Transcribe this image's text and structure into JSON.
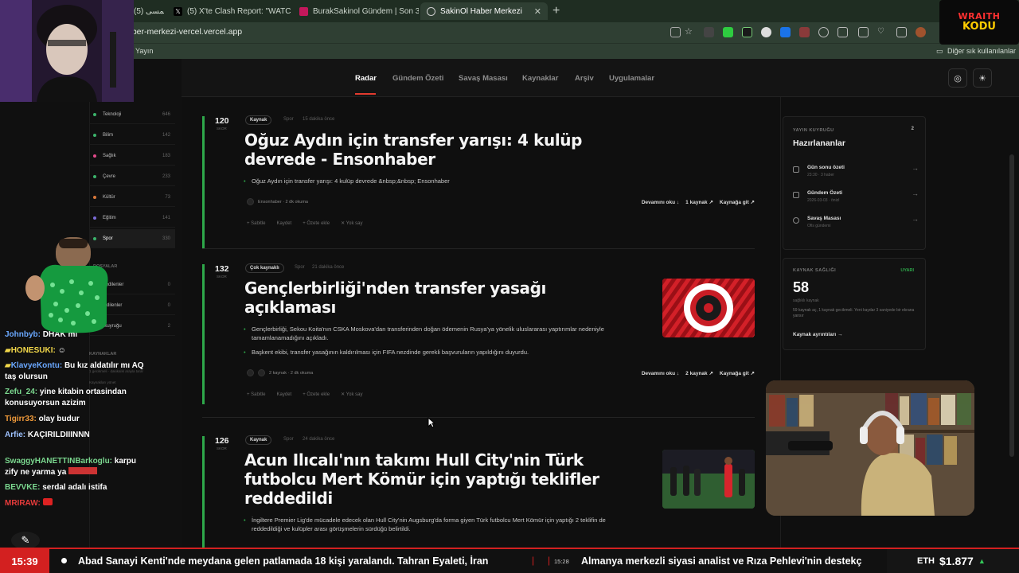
{
  "browser": {
    "tabs": [
      {
        "label": "شمسی (5)"
      },
      {
        "label": "(5) X'te Clash Report: \"WATCH: Ru"
      },
      {
        "label": "BurakSakinol Gündem | Son 3 Gün"
      },
      {
        "label": "SakinOl Haber Merkezi"
      }
    ],
    "url": "aber-merkezi-vercel.vercel.app",
    "bookmarks": {
      "left": "Yayın",
      "right": "Diğer sık kullanılanlar"
    }
  },
  "nav": {
    "items": [
      "Radar",
      "Gündem Özeti",
      "Savaş Masası",
      "Kaynaklar",
      "Arşiv",
      "Uygulamalar"
    ],
    "active": "Radar",
    "accent": "#e23a2e"
  },
  "categories": [
    {
      "label": "Teknoloji",
      "count": "646",
      "color": "#3bb36b"
    },
    {
      "label": "Bilim",
      "count": "142",
      "color": "#3bb36b"
    },
    {
      "label": "Sağlık",
      "count": "183",
      "color": "#e24a8a"
    },
    {
      "label": "Çevre",
      "count": "233",
      "color": "#3bb36b"
    },
    {
      "label": "Kültür",
      "count": "73",
      "color": "#d8783a"
    },
    {
      "label": "Eğitim",
      "count": "141",
      "color": "#7b6bd8"
    },
    {
      "label": "Spor",
      "count": "330",
      "color": "#3bb36b"
    }
  ],
  "sidebar_extra": {
    "section1": "DOSYALAR",
    "items": [
      {
        "label": "Takip edilenler",
        "count": "0"
      },
      {
        "label": "Kaydedilenler",
        "count": "0"
      },
      {
        "label": "Özet kuyruğu",
        "count": "2"
      }
    ],
    "section2": "KAYNAKLAR",
    "note": "1 gecikmeli · dakikalık arayla tarar",
    "note2": "Kaynakları yönet"
  },
  "chat": [
    {
      "user": "Johnbyb:",
      "msg": "DHAK mı",
      "color": "#6aa8ff"
    },
    {
      "user": "HONESUKI:",
      "msg": "",
      "color": "#f2d84a"
    },
    {
      "user": "KlavyeKontu:",
      "msg": "Bu kız aldatılır mı AQ taş olursun",
      "color": "#6aa8ff"
    },
    {
      "user": "Zefu_24:",
      "msg": "yine kitabin ortasindan konusuyorsun azizim",
      "color": "#7bd88f"
    },
    {
      "user": "Tigirr33:",
      "msg": "olay budur",
      "color": "#f29b3a"
    },
    {
      "user": "Arfie:",
      "msg": "KAÇIRILDIIINNN",
      "color": "#9ec2ff"
    },
    {
      "user": "SwaggyHANETTINBarkoglu:",
      "msg": "karpu zify ne yarma ya",
      "color": "#7bd88f"
    },
    {
      "user": "BEVVKE:",
      "msg": "serdal adalı istifa",
      "color": "#7bd88f"
    },
    {
      "user": "MRIRAW:",
      "msg": "",
      "color": "#e63b3b"
    }
  ],
  "articles": [
    {
      "number": "120",
      "number_label": "SKOR",
      "badge": "Kaynak",
      "category": "Spor",
      "time": "15 dakika önce",
      "title": "Oğuz Aydın için transfer yarışı: 4 kulüp devrede - Ensonhaber",
      "bullets": [
        "Oğuz Aydın için transfer yarışı: 4 kulüp devrede &nbsp;&nbsp; Ensonhaber"
      ],
      "source": "Ensonhaber · 2 dk okuma",
      "links": {
        "more": "Devamını oku ↓",
        "sources": "1 kaynak ↗",
        "go": "Kaynağa git ↗"
      },
      "footer": [
        "+ Sabitle",
        "Kaydet",
        "+ Özete ekle",
        "✕ Yok say"
      ]
    },
    {
      "number": "132",
      "number_label": "SKOR",
      "badge": "Çok kaynaklı",
      "category": "Spor",
      "time": "21 dakika önce",
      "title": "Gençlerbirliği'nden transfer yasağı açıklaması",
      "bullets": [
        "Gençlerbirliği, Sekou Koita'nın CSKA Moskova'dan transferinden doğan ödemenin Rusya'ya yönelik uluslararası yaptırımlar nedeniyle tamamlanamadığını açıkladı.",
        "Başkent ekibi, transfer yasağının kaldırılması için FIFA nezdinde gerekli başvuruların yapıldığını duyurdu."
      ],
      "source": "2 kaynak · 2 dk okuma",
      "links": {
        "more": "Devamını oku ↓",
        "sources": "2 kaynak ↗",
        "go": "Kaynağa git ↗"
      },
      "footer": [
        "+ Sabitle",
        "Kaydet",
        "+ Özete ekle",
        "✕ Yok say"
      ],
      "logo_text": "ANKARA · GENÇLERBİRLİĞİ SPOR KULÜBÜ"
    },
    {
      "number": "126",
      "number_label": "SKOR",
      "badge": "Kaynak",
      "category": "Spor",
      "time": "24 dakika önce",
      "title": "Acun Ilıcalı'nın takımı Hull City'nin Türk futbolcu Mert Kömür için yaptığı teklifler reddedildi",
      "bullets": [
        "İngiltere Premier Lig'de mücadele edecek olan Hull City'nin Augsburg'da forma giyen Türk futbolcu Mert Kömür için yaptığı 2 teklifin de reddedildiği ve kulüpler arası görüşmelerin sürdüğü belirtildi."
      ]
    }
  ],
  "queue": {
    "label": "YAYIN KUYRUĞU",
    "count": "2",
    "title": "Hazırlananlar",
    "items": [
      {
        "title": "Gün sonu özeti",
        "sub": "23:30 · 3 haber"
      },
      {
        "title": "Gündem Özeti",
        "sub": "2026-03-03 · önizl"
      },
      {
        "title": "Savaş Masası",
        "sub": "Ofis gündemi"
      }
    ]
  },
  "health": {
    "label": "KAYNAK SAĞLIĞI",
    "status": "UYARI",
    "status_color": "#2ea84a",
    "value": "58",
    "value_label": "sağlıklı kaynak",
    "note": "59 kaynak aç, 1 kaynak gecikmeli. Yeni kaydar 3 saniyede bir ekrana yansır",
    "link": "Kaynak ayrıntıları →"
  },
  "ticker": {
    "time": "15:39",
    "text1": "Abad Sanayi Kenti'nde meydana gelen patlamada 18 kişi yaralandı. Tahran Eyaleti, İran",
    "time2": "15:28",
    "text2": "Almanya merkezli siyasi analist ve Rıza Pehlevi'nin destekç",
    "eth_symbol": "ETH",
    "eth_price": "$1.877",
    "eth_dir": "▲"
  },
  "brand": {
    "line1": "WRAITH",
    "line2": "KODU"
  }
}
